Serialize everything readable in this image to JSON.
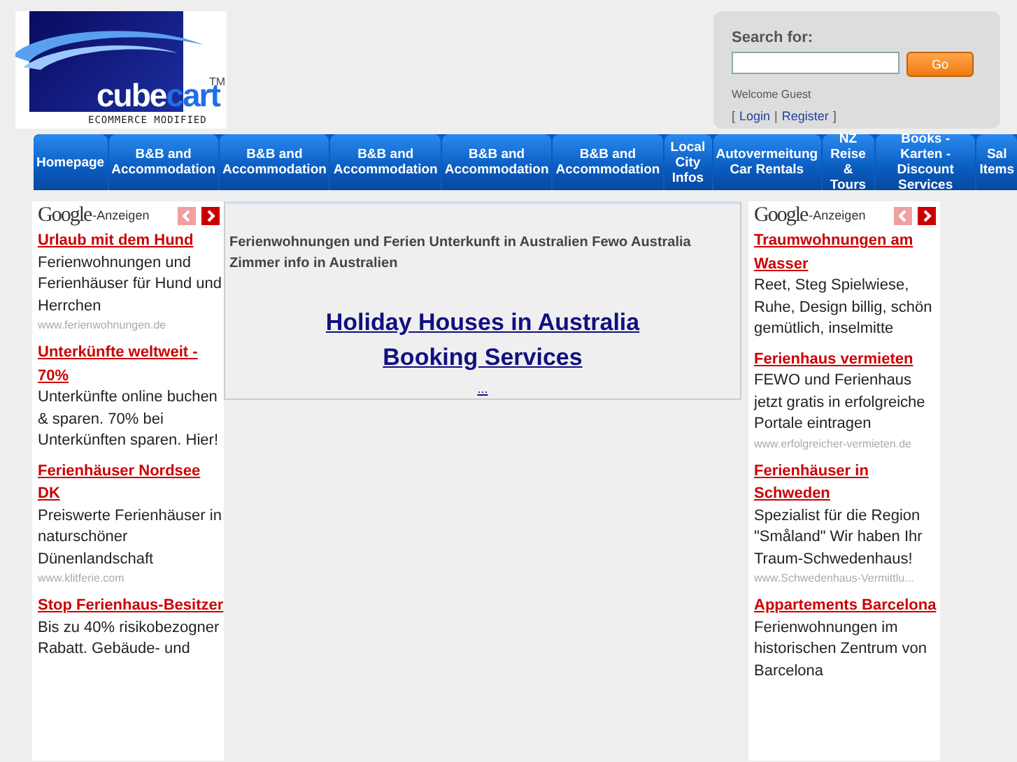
{
  "logo": {
    "word_1": "cube",
    "word_2": "cart",
    "trademark": "TM",
    "tagline": "ECOMMERCE MODIFIED"
  },
  "search": {
    "label": "Search for:",
    "button": "Go",
    "welcome": "Welcome Guest",
    "open_bracket": "[",
    "links": [
      "Login",
      "Register"
    ],
    "separator": "|",
    "close_bracket": "]"
  },
  "nav": [
    {
      "label": "Homepage"
    },
    {
      "label": "B&B and Accommodation"
    },
    {
      "label": "B&B and Accommodation"
    },
    {
      "label": "B&B and Accommodation"
    },
    {
      "label": "B&B and Accommodation"
    },
    {
      "label": "B&B and Accommodation"
    },
    {
      "label": "Local City Infos"
    },
    {
      "label": "Autovermeitung Car Rentals"
    },
    {
      "label": "NZ Reise & Tours"
    },
    {
      "label": "Books - Karten - Discount Services"
    },
    {
      "label": "Sal Items"
    }
  ],
  "ads_left": {
    "brand": "Google",
    "suffix": "-Anzeigen",
    "prev_disabled": true,
    "next_disabled": false,
    "ads": [
      {
        "title": "Urlaub mit dem Hund",
        "text": "Ferienwohnungen und Ferienhäuser für Hund und Herrchen",
        "url": "www.ferienwohnungen.de"
      },
      {
        "title": "Unterkünfte weltweit - 70%",
        "text": "Unterkünfte online buchen & sparen. 70% bei Unterkünften sparen. Hier!"
      },
      {
        "title": "Ferienhäuser Nordsee DK",
        "text": "Preiswerte Ferienhäuser in naturschöner Dünenlandschaft",
        "url": "www.klitferie.com"
      },
      {
        "title": "Stop Ferienhaus-Besitzer",
        "text": "Bis zu 40% risikobezogner Rabatt. Gebäude- und"
      }
    ]
  },
  "main": {
    "intro": "Ferienwohnungen und Ferien Unterkunft in Australien Fewo Australia Zimmer info in Australien",
    "headline": "Holiday Houses in Australia Booking Services",
    "more": "..."
  },
  "ads_right": {
    "brand": "Google",
    "suffix": "-Anzeigen",
    "prev_disabled": true,
    "next_disabled": false,
    "ads": [
      {
        "title": "Traumwohnungen am Wasser",
        "text": "Reet, Steg Spielwiese, Ruhe, Design billig, schön gemütlich, inselmitte"
      },
      {
        "title": "Ferienhaus vermieten",
        "text": "FEWO und Ferienhaus jetzt gratis in erfolgreiche Portale eintragen",
        "url": "www.erfolgreicher-vermieten.de"
      },
      {
        "title": "Ferienhäuser in Schweden",
        "text": "Spezialist für die Region \"Småland\" Wir haben Ihr Traum-Schwedenhaus!",
        "url": "www.Schwedenhaus-Vermittlu..."
      },
      {
        "title": "Appartements Barcelona",
        "text": "Ferienwohnungen im historischen Zentrum von Barcelona"
      }
    ]
  }
}
